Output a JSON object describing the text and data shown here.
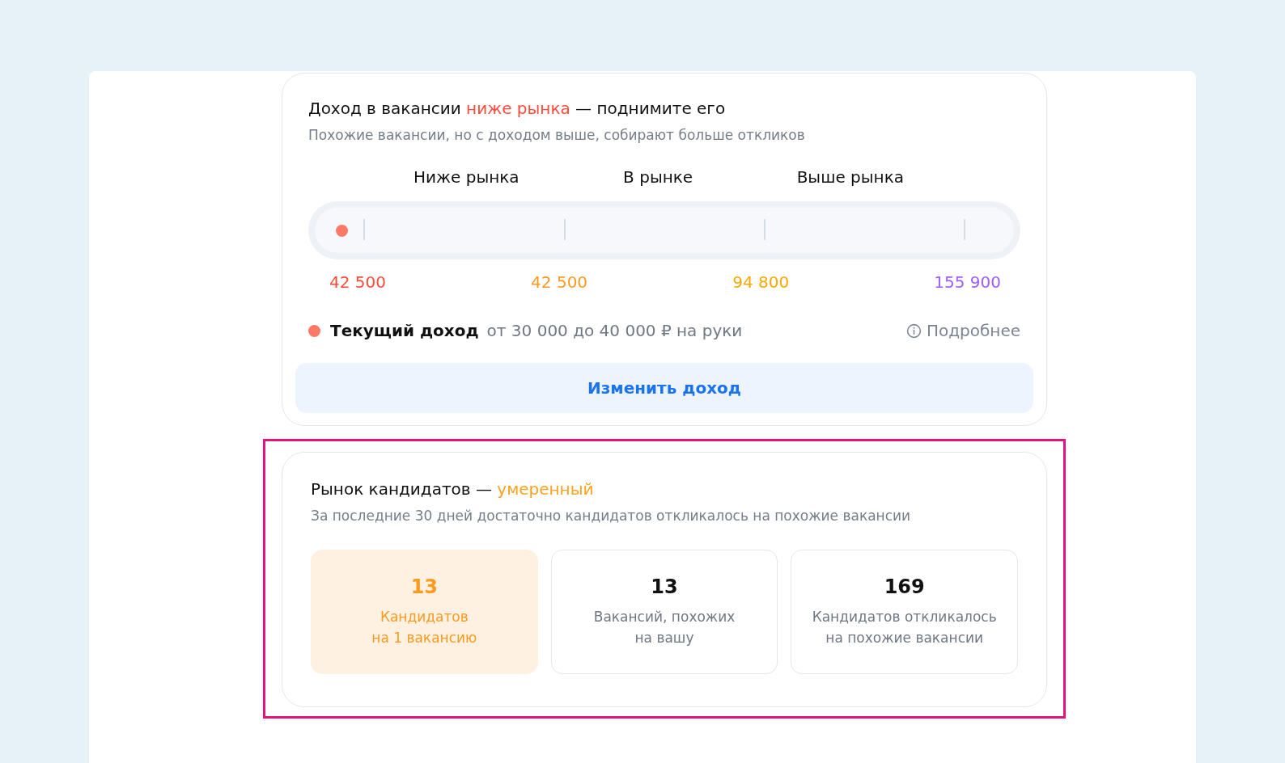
{
  "income": {
    "title": [
      {
        "kind": "plain",
        "text": "Доход в вакансии "
      },
      {
        "kind": "accent",
        "text": "ниже рынка"
      },
      {
        "kind": "plain",
        "text": " — поднимите его"
      }
    ],
    "subtitle": "Похожие вакансии, но с доходом выше, собирают больше откликов",
    "scale_labels": [
      "Ниже рынка",
      "В рынке",
      "Выше рынка"
    ],
    "ticks": [
      {
        "value": "42 500",
        "color": "#ff4b3a"
      },
      {
        "value": "42 500",
        "color": "#ff9a1f"
      },
      {
        "value": "94 800",
        "color": "#ffa800"
      },
      {
        "value": "155 900",
        "color": "#a05cff"
      }
    ],
    "current": {
      "level": 0.03,
      "label": "Текущий доход",
      "value": "от 30 000 до 40 000 ₽ на руки",
      "color": "#ff7a66"
    },
    "details_link": "Подробнее",
    "button": "Изменить доход"
  },
  "market": {
    "highlighted": true,
    "title": [
      {
        "kind": "plain",
        "text": "Рынок кандидатов — "
      },
      {
        "kind": "warn",
        "text": "умеренный"
      }
    ],
    "subtitle": "За последние 30 дней достаточно кандидатов откликалось на похожие вакансии",
    "stats": [
      {
        "value": "13",
        "lines": [
          "Кандидатов",
          "на 1 вакансию"
        ],
        "selected": true
      },
      {
        "value": "13",
        "lines": [
          "Вакансий, похожих",
          "на вашу"
        ],
        "selected": false
      },
      {
        "value": "169",
        "lines": [
          "Кандидатов откликалось",
          "на похожие вакансии"
        ],
        "selected": false
      }
    ]
  }
}
